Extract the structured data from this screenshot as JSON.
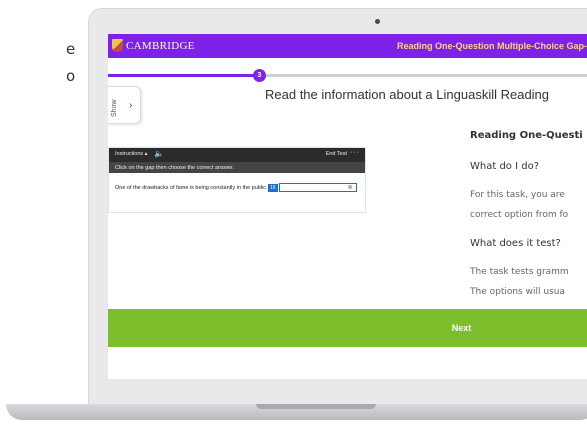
{
  "left_snippets": [
    "e",
    "o"
  ],
  "header": {
    "logo_text": "CAMBRIDGE",
    "title": "Reading One-Question Multiple-Choice Gap-f"
  },
  "progress": {
    "step": "3"
  },
  "page_heading": "Read the information about a Linguaskill Reading",
  "show_tab": {
    "label": "Show",
    "chevron": "›"
  },
  "task_preview": {
    "instructions": "Instructions",
    "end_test": "End Test",
    "instruction_text": "Click on the gap then choose the correct answer.",
    "question": "One of the drawbacks of fame is being constantly in the public",
    "gap_number": "16"
  },
  "info_panel": {
    "title": "Reading One-Questi",
    "h1": "What do I do?",
    "p1_line1": "For this task, you are",
    "p1_line2": "correct option from fo",
    "h2": "What does it test?",
    "p2_line1": "The task tests gramm",
    "p2_line2": "The options will usua"
  },
  "next_label": "Next",
  "colors": {
    "header": "#7d22e8",
    "next_bar": "#7bbd2b",
    "header_title": "#ffd27a"
  }
}
